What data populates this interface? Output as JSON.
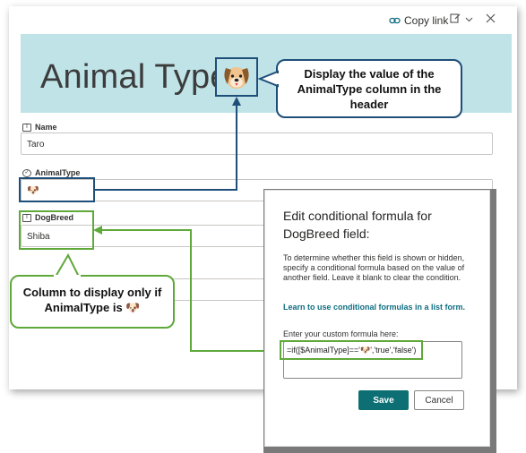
{
  "topbar": {
    "copy_link": "Copy link"
  },
  "header": {
    "title": "Animal Type:"
  },
  "fields": {
    "name": {
      "label": "Name",
      "value": "Taro"
    },
    "animal_type": {
      "label": "AnimalType",
      "value": "🐶"
    },
    "dog_breed": {
      "label": "DogBreed",
      "value": "Shiba"
    }
  },
  "callouts": {
    "header_note": "Display the value of the AnimalType column in the header",
    "column_note": "Column to display only if AnimalType is"
  },
  "panel": {
    "title": "Edit conditional formula for DogBreed field:",
    "description": "To determine whether this field is shown or hidden, specify a conditional formula based on the value of another field. Leave it blank to clear the condition.",
    "link": "Learn to use conditional formulas in a list form.",
    "enter_label": "Enter your custom formula here:",
    "formula": "=if([$AnimalType]=='🐶','true','false')",
    "save": "Save",
    "cancel": "Cancel"
  },
  "colors": {
    "header_band": "#bfe3e7",
    "accent_teal": "#0d6f73",
    "callout_blue": "#1f4e79",
    "callout_green": "#5fa83a"
  },
  "icons": [
    "link-icon",
    "edit-icon",
    "chevron-down-icon",
    "close-icon",
    "dog-face-icon",
    "text-field-icon",
    "choice-field-icon"
  ]
}
